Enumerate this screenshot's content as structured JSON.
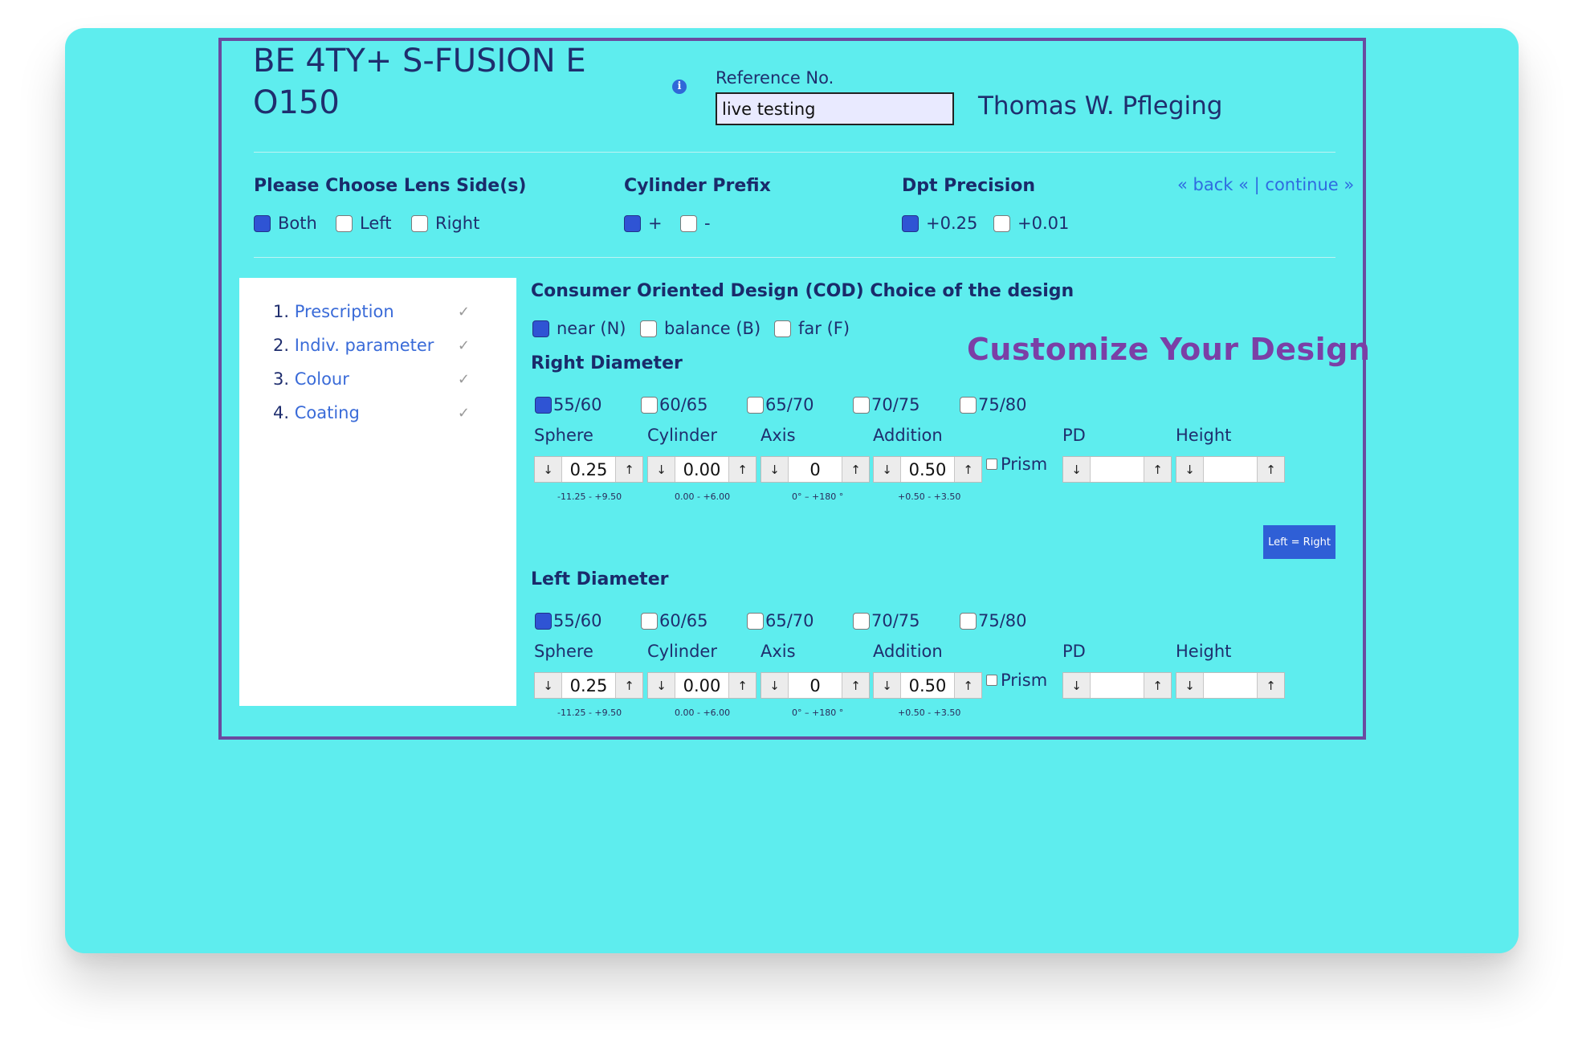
{
  "product": {
    "title": "BE 4TY+ S-FUSION E\nO150"
  },
  "reference": {
    "label": "Reference No.",
    "value": "live testing"
  },
  "user": {
    "name": "Thomas W. Pfleging"
  },
  "lens_sides": {
    "title": "Please Choose Lens Side(s)",
    "options": [
      {
        "label": "Both",
        "checked": true
      },
      {
        "label": "Left",
        "checked": false
      },
      {
        "label": "Right",
        "checked": false
      }
    ]
  },
  "cyl_prefix": {
    "title": "Cylinder Prefix",
    "options": [
      {
        "label": "+",
        "checked": true
      },
      {
        "label": "-",
        "checked": false
      }
    ]
  },
  "dpt_precision": {
    "title": "Dpt Precision",
    "options": [
      {
        "label": "+0.25",
        "checked": true
      },
      {
        "label": "+0.01",
        "checked": false
      }
    ]
  },
  "nav": {
    "back": "« back «",
    "separator": "|",
    "continue": "continue »"
  },
  "steps": [
    {
      "num": "1.",
      "label": "Prescription"
    },
    {
      "num": "2.",
      "label": "Indiv. parameter"
    },
    {
      "num": "3.",
      "label": "Colour"
    },
    {
      "num": "4.",
      "label": "Coating"
    }
  ],
  "cod": {
    "title": "Consumer Oriented Design (COD) Choice of the design",
    "options": [
      {
        "label": "near (N)",
        "checked": true
      },
      {
        "label": "balance (B)",
        "checked": false
      },
      {
        "label": "far (F)",
        "checked": false
      }
    ]
  },
  "heading": "Customize Your  Design",
  "fields": {
    "sphere": "Sphere",
    "cylinder": "Cylinder",
    "axis": "Axis",
    "addition": "Addition",
    "pd": "PD",
    "height": "Height",
    "prism": "Prism"
  },
  "ranges": {
    "sphere": "-11.25  -  +9.50",
    "cylinder": "0.00  -  +6.00",
    "axis": "0° – +180 °",
    "addition": "+0.50  -  +3.50"
  },
  "arrows": {
    "down": "↓",
    "up": "↑"
  },
  "check_mark": "✓",
  "info_icon": "i",
  "right": {
    "title": "Right Diameter",
    "diameters": [
      {
        "label": "55/60",
        "checked": true
      },
      {
        "label": "60/65",
        "checked": false
      },
      {
        "label": "65/70",
        "checked": false
      },
      {
        "label": "70/75",
        "checked": false
      },
      {
        "label": "75/80",
        "checked": false
      }
    ],
    "values": {
      "sphere": "0.25",
      "cylinder": "0.00",
      "axis": "0",
      "addition": "0.50",
      "pd": "",
      "height": ""
    }
  },
  "left_right_button": "Left = Right",
  "left": {
    "title": "Left Diameter",
    "diameters": [
      {
        "label": "55/60",
        "checked": true
      },
      {
        "label": "60/65",
        "checked": false
      },
      {
        "label": "65/70",
        "checked": false
      },
      {
        "label": "70/75",
        "checked": false
      },
      {
        "label": "75/80",
        "checked": false
      }
    ],
    "values": {
      "sphere": "0.25",
      "cylinder": "0.00",
      "axis": "0",
      "addition": "0.50",
      "pd": "",
      "height": ""
    }
  },
  "colors": {
    "background": "#5eedee",
    "frame": "#6a4aa0",
    "accent": "#2f54d4",
    "heading": "#7b3fa6",
    "link": "#3a6bd8"
  }
}
